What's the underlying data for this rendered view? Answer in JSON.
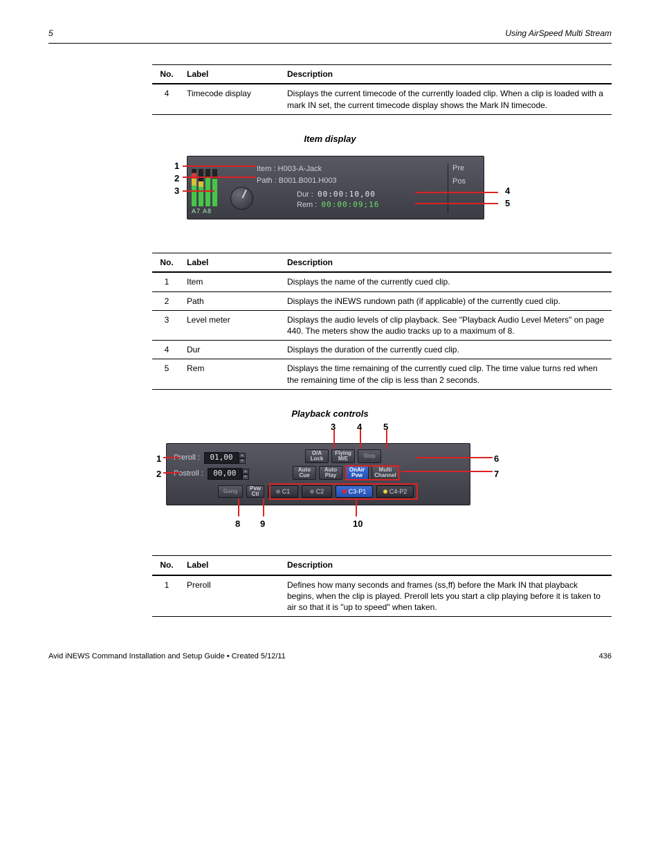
{
  "header": {
    "leftTitle": "Using AirSpeed Multi Stream",
    "pageRef": "5"
  },
  "table1": {
    "cols": [
      "No.",
      "Label",
      "Description"
    ],
    "rows": [
      {
        "num": "4",
        "label": "Timecode display",
        "desc": "Displays the current timecode of the currently loaded clip. When a clip is loaded with a mark IN set, the current timecode display shows the Mark IN timecode."
      }
    ]
  },
  "section1Title": "Item display",
  "panel1": {
    "item": "Item  : H003-A-Jack",
    "path": "Path  : B001.B001.H003",
    "durLabel": "Dur    :",
    "durVal": "00:00:10,00",
    "remLabel": "Rem   :",
    "remVal": "00:00:09;16",
    "meterLbl": "A7  A8",
    "pre": "Pre",
    "pos": "Pos"
  },
  "callouts1": {
    "left": [
      "1",
      "2",
      "3"
    ],
    "right": [
      "4",
      "5"
    ]
  },
  "table2": {
    "cols": [
      "No.",
      "Label",
      "Description"
    ],
    "rows": [
      {
        "num": "1",
        "label": "Item",
        "desc": "Displays the name of the currently cued clip."
      },
      {
        "num": "2",
        "label": "Path",
        "desc": "Displays the iNEWS rundown path (if applicable) of the currently cued clip."
      },
      {
        "num": "3",
        "label": "Level meter",
        "desc": "Displays the audio levels of clip playback. See \"Playback Audio Level Meters\" on page 440. The meters show the audio tracks up to a maximum of 8."
      },
      {
        "num": "4",
        "label": "Dur",
        "desc": "Displays the duration of the currently cued clip."
      },
      {
        "num": "5",
        "label": "Rem",
        "desc": "Displays the time remaining of the currently cued clip. The time value turns red when the remaining time of the clip is less than 2 seconds."
      }
    ]
  },
  "section2Title": "Playback controls",
  "panel2": {
    "prerollLabel": "Preroll   :",
    "prerollVal": "01,00",
    "postrollLabel": "Postroll :",
    "postrollVal": "00,00",
    "btns": {
      "oaLock": "O/A\nLock",
      "flyingMe": "Flying\nM/E",
      "step": "Step",
      "autoCue": "Auto\nCue",
      "autoPlay": "Auto\nPlay",
      "onAirPvw": "OnAir\nPvw",
      "multiChan": "Multi\nChannel"
    },
    "gang": "Gang",
    "pvwCtl": "Pvw\nCtl",
    "channels": [
      {
        "label": "C1",
        "dot": ""
      },
      {
        "label": "C2",
        "dot": ""
      },
      {
        "label": "C3-P1",
        "dot": "red",
        "sel": true
      },
      {
        "label": "C4-P2",
        "dot": "yel"
      }
    ]
  },
  "callouts2": {
    "top": [
      "3",
      "4",
      "5"
    ],
    "right": [
      "6",
      "7"
    ],
    "left": [
      "1",
      "2"
    ],
    "bottom": [
      "8",
      "9",
      "10"
    ]
  },
  "table3": {
    "cols": [
      "No.",
      "Label",
      "Description"
    ],
    "rows": [
      {
        "num": "1",
        "label": "Preroll",
        "desc": "Defines how many seconds and frames (ss,ff) before the Mark IN that playback begins, when the clip is played. Preroll lets you start a clip playing before it is taken to air so that it is \"up to speed\" when taken."
      }
    ]
  },
  "footer": {
    "left": "Avid iNEWS Command Installation and Setup Guide • Created 5/12/11",
    "right": "436"
  }
}
